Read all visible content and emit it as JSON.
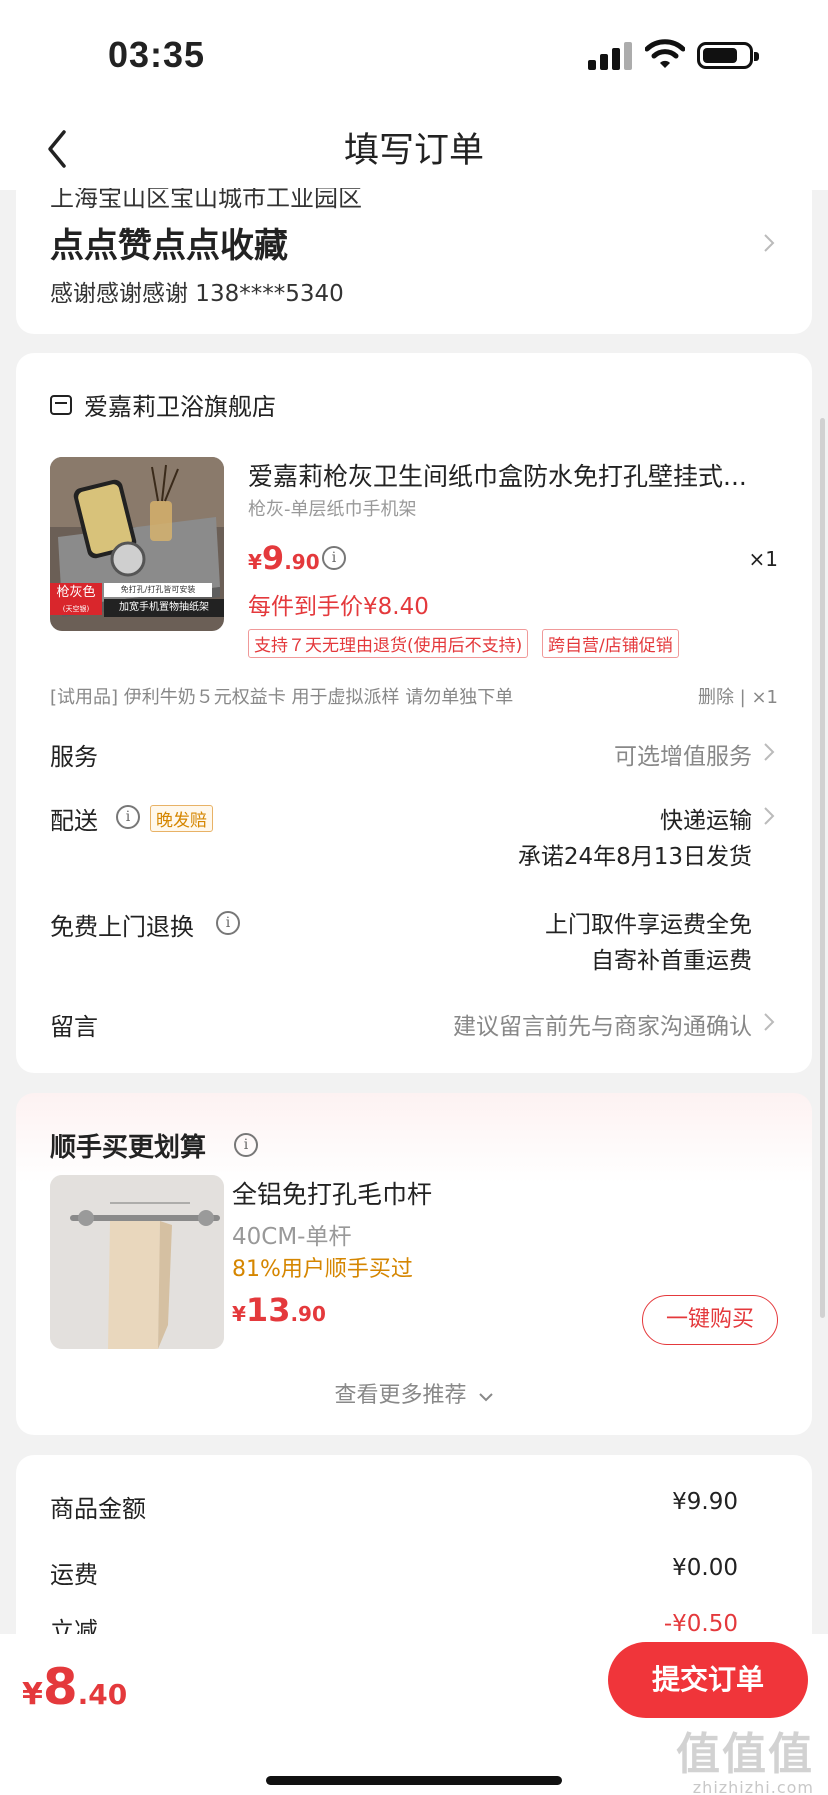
{
  "status_bar": {
    "time": "03:35"
  },
  "nav": {
    "title": "填写订单"
  },
  "address": {
    "cut_line": "上海宝山区宝山城市工业园区",
    "name": "点点赞点点收藏",
    "contact": "感谢感谢感谢  138****5340"
  },
  "shop": {
    "name": "爱嘉莉卫浴旗舰店",
    "product": {
      "name": "爱嘉莉枪灰卫生间纸巾盒防水免打孔壁挂式...",
      "sku": "枪灰-单层纸巾手机架",
      "price": {
        "symbol": "¥",
        "int": "9",
        "dec": ".90"
      },
      "qty": "×1",
      "unit_price": "每件到手价¥8.40",
      "tags": [
        "支持７天无理由退货(使用后不支持)",
        "跨自营/店铺促销"
      ],
      "thumb_labels": {
        "color": "枪灰色",
        "color_sub": "(天空银)",
        "line1": "免打孔/打孔皆可安装",
        "line2": "加宽手机置物抽纸架"
      }
    },
    "trial": {
      "text": "[试用品]  伊利牛奶５元权益卡 用于虚拟派样 请勿单独下单",
      "ops": "删除 | ×1"
    },
    "rows": {
      "service": {
        "label": "服务",
        "value": "可选增值服务"
      },
      "delivery": {
        "label": "配送",
        "badge": "晚发赔",
        "value": "快递运输",
        "value2": "承诺24年8月13日发货"
      },
      "return": {
        "label": "免费上门退换",
        "value": "上门取件享运费全免",
        "value2": "自寄补首重运费"
      },
      "message": {
        "label": "留言",
        "value": "建议留言前先与商家沟通确认"
      }
    }
  },
  "recommend": {
    "title": "顺手买更划算",
    "product": {
      "name": "全铝免打孔毛巾杆",
      "sku": "40CM-单杆",
      "pct": "81%用户顺手买过",
      "price": {
        "symbol": "¥",
        "int": "13",
        "dec": ".90"
      },
      "buy_label": "一键购买"
    },
    "more_label": "查看更多推荐"
  },
  "summary": {
    "rows": [
      {
        "label": "商品金额",
        "value": "¥9.90"
      },
      {
        "label": "运费",
        "value": "¥0.00"
      },
      {
        "label": "立减",
        "value": "-¥0.50"
      }
    ]
  },
  "bottom": {
    "total": {
      "symbol": "¥",
      "int": "8",
      "dec": ".40"
    },
    "submit_label": "提交订单",
    "watermark": {
      "big": "值值值",
      "small": "zhizhizhi.com"
    }
  },
  "colors": {
    "accent": "#e4393c",
    "submit": "#f0353a",
    "orange": "#d58600",
    "bg": "#f2f2f2"
  }
}
